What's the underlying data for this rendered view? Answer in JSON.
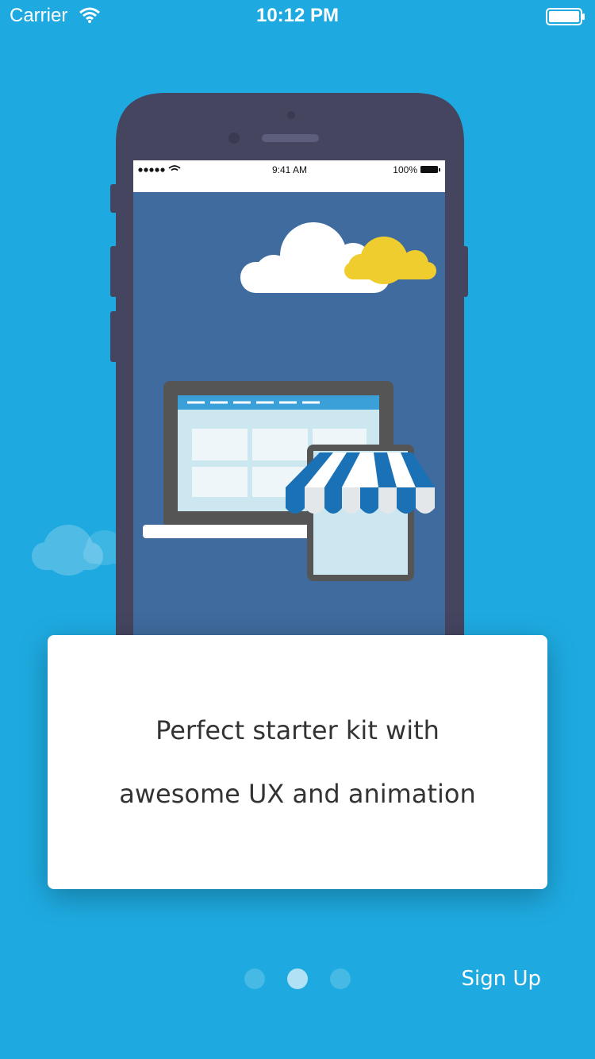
{
  "status_bar": {
    "carrier": "Carrier",
    "time": "10:12 PM"
  },
  "mock_phone_status": {
    "time": "9:41 AM",
    "battery": "100%"
  },
  "card": {
    "line1": "Perfect starter kit with",
    "line2": "awesome UX and animation"
  },
  "pager": {
    "total": 3,
    "active_index": 1
  },
  "actions": {
    "signup_label": "Sign Up"
  },
  "colors": {
    "background": "#1eaae0",
    "phone_body": "#454560",
    "phone_screen": "#406b9e",
    "cloud_yellow": "#efcd2e",
    "awning_blue": "#1a71b6"
  }
}
